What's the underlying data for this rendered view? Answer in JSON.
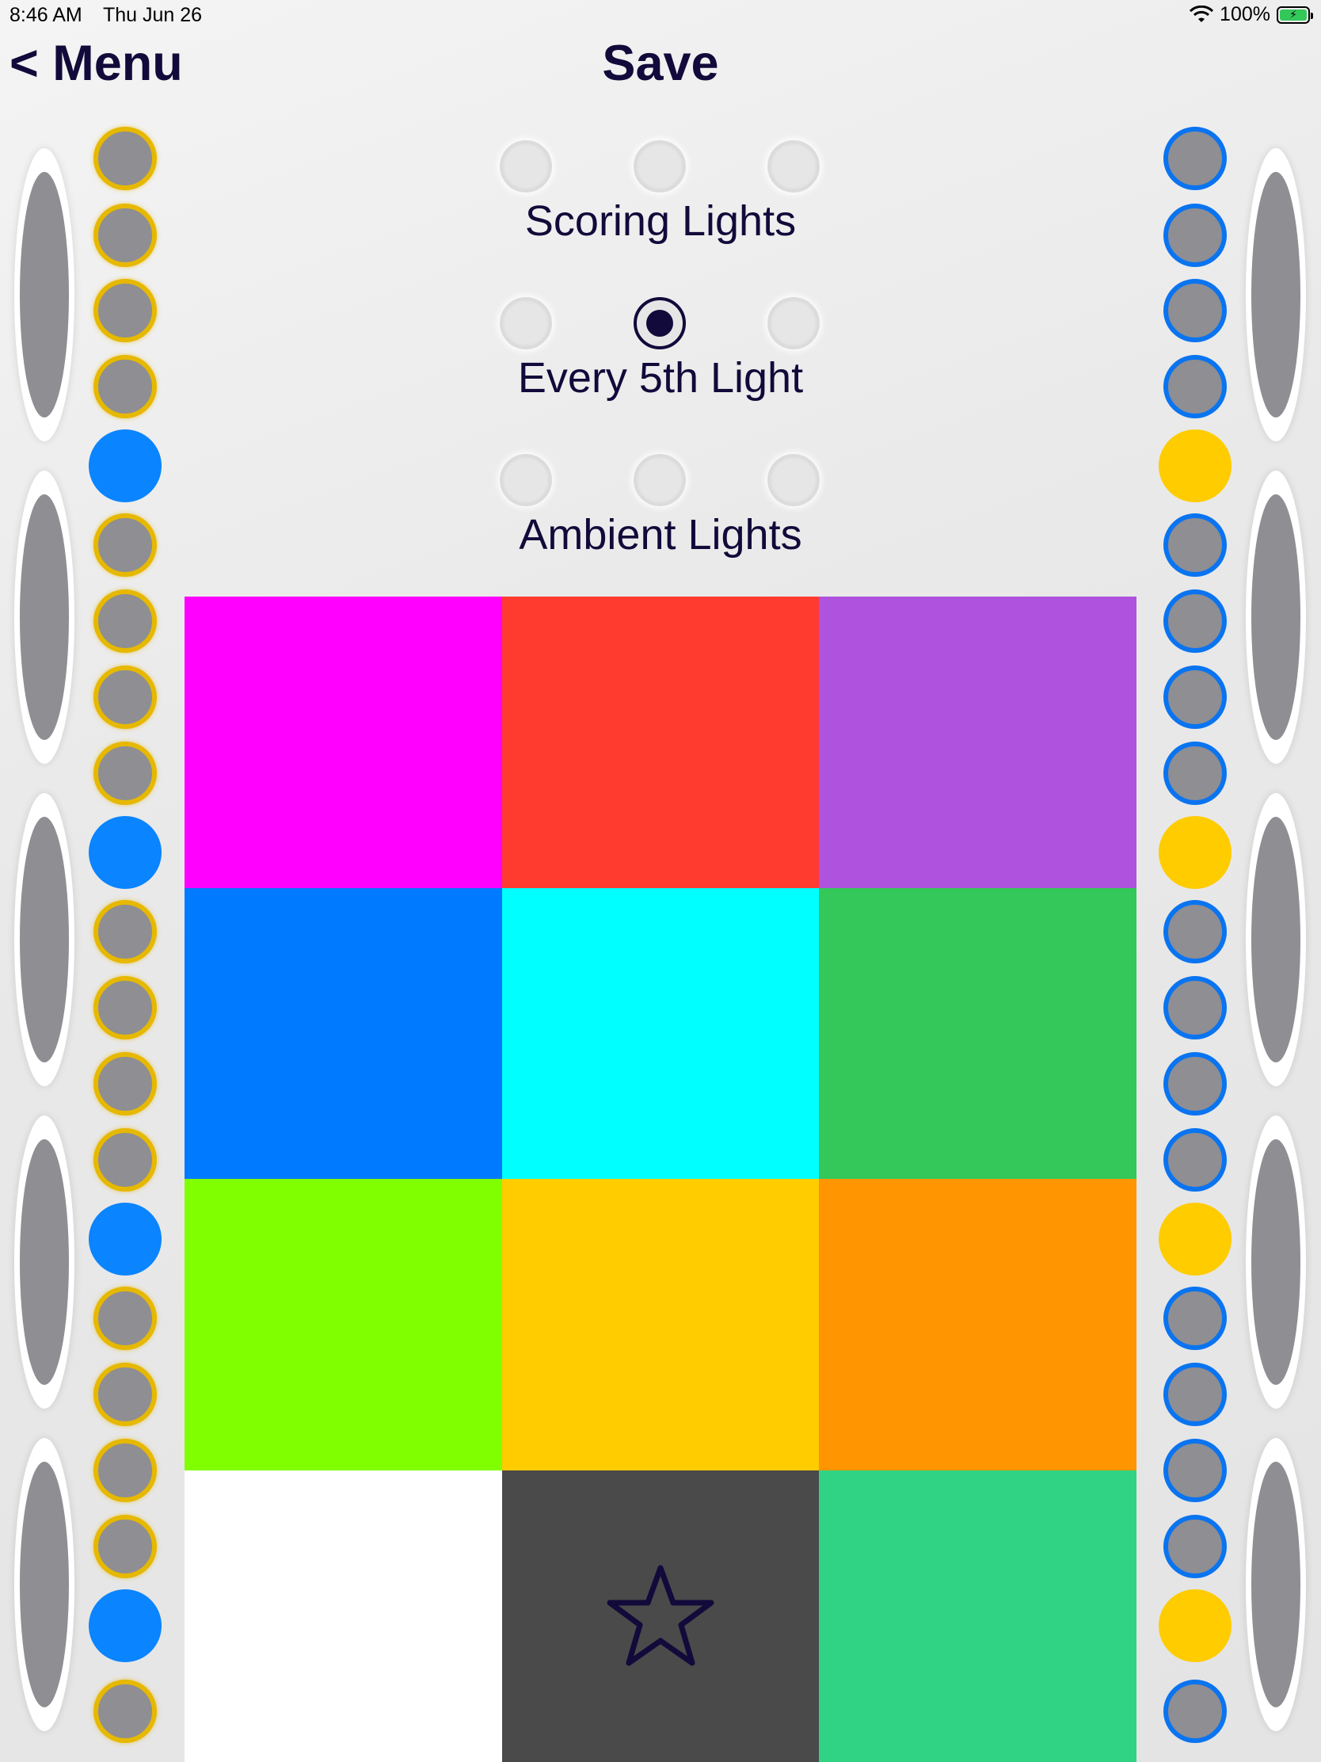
{
  "status": {
    "time": "8:46 AM",
    "date": "Thu Jun 26",
    "battery": "100%",
    "wifi_icon": "wifi-icon",
    "battery_icon": "battery-charging-icon"
  },
  "nav": {
    "back_label": "< Menu",
    "title": "Save"
  },
  "modes": [
    {
      "label": "Scoring Lights",
      "selected_index": -1
    },
    {
      "label": "Every 5th Light",
      "selected_index": 1
    },
    {
      "label": "Ambient Lights",
      "selected_index": -1
    }
  ],
  "palette": [
    "#ff00ff",
    "#ff3b30",
    "#af52de",
    "#007aff",
    "#00ffff",
    "#34c759",
    "#80ff00",
    "#ffcc00",
    "#ff9500",
    "#ffffff",
    "#4a4a4a",
    "#2fd383"
  ],
  "favorite_icon": "star-icon",
  "left_column": [
    "ring-yellow",
    "ring-yellow",
    "ring-yellow",
    "ring-yellow",
    "fill-blue",
    "ring-yellow",
    "ring-yellow",
    "ring-yellow",
    "ring-yellow",
    "fill-blue",
    "ring-yellow",
    "ring-yellow",
    "ring-yellow",
    "ring-yellow",
    "fill-blue",
    "ring-yellow",
    "ring-yellow",
    "ring-yellow",
    "ring-yellow",
    "fill-blue",
    "ring-yellow"
  ],
  "right_column": [
    "ring-blue",
    "ring-blue",
    "ring-blue",
    "ring-blue",
    "fill-yellow",
    "ring-blue",
    "ring-blue",
    "ring-blue",
    "ring-blue",
    "fill-yellow",
    "ring-blue",
    "ring-blue",
    "ring-blue",
    "ring-blue",
    "fill-yellow",
    "ring-blue",
    "ring-blue",
    "ring-blue",
    "ring-blue",
    "fill-yellow",
    "ring-blue"
  ]
}
